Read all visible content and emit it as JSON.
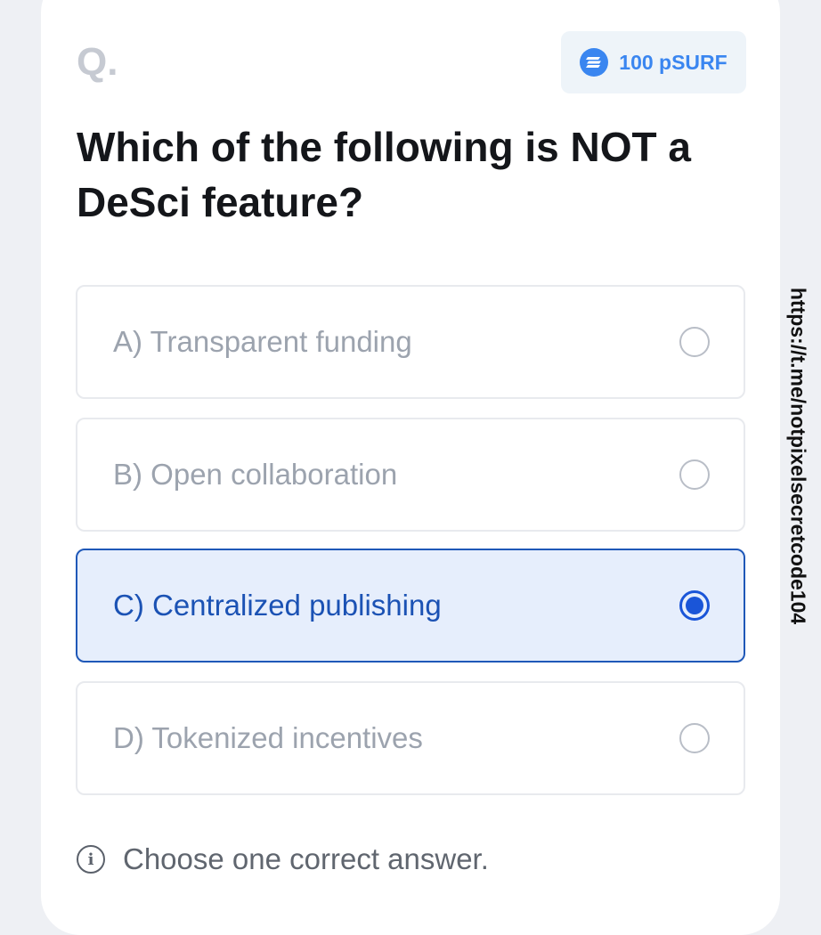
{
  "header": {
    "question_marker": "Q.",
    "reward": {
      "amount_text": "100 pSURF",
      "icon": "coin-icon",
      "accent_color": "#3a86f0"
    }
  },
  "question": {
    "text": "Which of the following is NOT a DeSci feature?"
  },
  "options": [
    {
      "label": "A) Transparent funding",
      "selected": false
    },
    {
      "label": "B) Open collaboration",
      "selected": false
    },
    {
      "label": "C) Centralized publishing",
      "selected": true
    },
    {
      "label": "D) Tokenized incentives",
      "selected": false
    }
  ],
  "hint": {
    "icon": "info-icon",
    "glyph": "i",
    "text": "Choose one correct answer."
  },
  "watermark": {
    "text": "https://t.me/notpixelsecretcode104"
  },
  "colors": {
    "selected_accent": "#1a55d8",
    "selected_background": "#e6eefc",
    "unselected_text": "#9ca3ae"
  }
}
